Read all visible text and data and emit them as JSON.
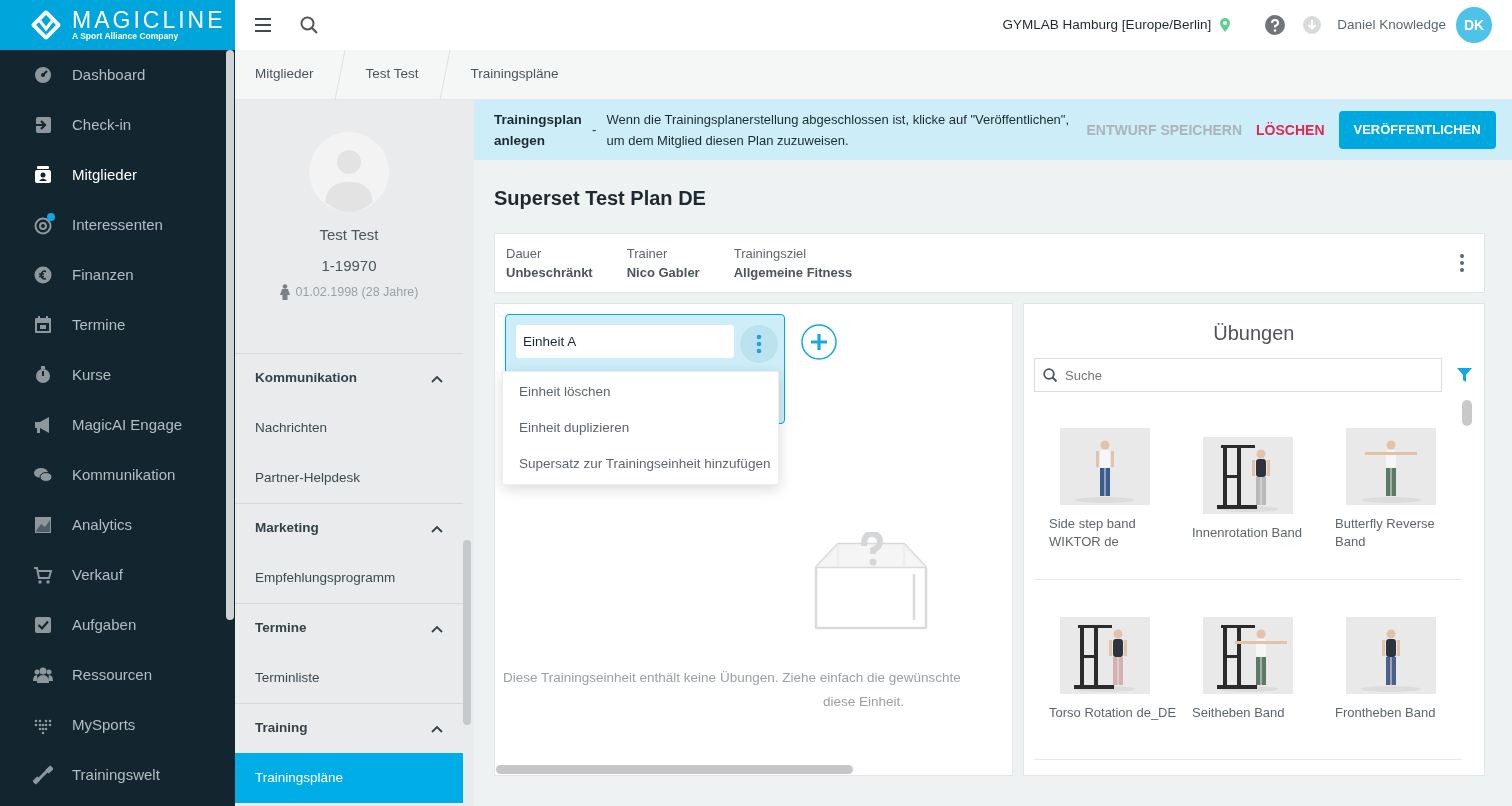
{
  "brand": {
    "name": "MAGICLINE",
    "tagline": "A Sport Alliance Company"
  },
  "nav": [
    {
      "label": "Dashboard",
      "selected": false,
      "notification": false
    },
    {
      "label": "Check-in",
      "selected": false,
      "notification": false
    },
    {
      "label": "Mitglieder",
      "selected": true,
      "notification": false
    },
    {
      "label": "Interessenten",
      "selected": false,
      "notification": true
    },
    {
      "label": "Finanzen",
      "selected": false,
      "notification": false
    },
    {
      "label": "Termine",
      "selected": false,
      "notification": false
    },
    {
      "label": "Kurse",
      "selected": false,
      "notification": false
    },
    {
      "label": "MagicAI Engage",
      "selected": false,
      "notification": false
    },
    {
      "label": "Kommunikation",
      "selected": false,
      "notification": false
    },
    {
      "label": "Analytics",
      "selected": false,
      "notification": false
    },
    {
      "label": "Verkauf",
      "selected": false,
      "notification": false
    },
    {
      "label": "Aufgaben",
      "selected": false,
      "notification": false
    },
    {
      "label": "Ressourcen",
      "selected": false,
      "notification": false
    },
    {
      "label": "MySports",
      "selected": false,
      "notification": false
    },
    {
      "label": "Trainingswelt",
      "selected": false,
      "notification": false
    }
  ],
  "header": {
    "location": "GYMLAB Hamburg [Europe/Berlin]",
    "user": "Daniel Knowledge",
    "initials": "DK"
  },
  "breadcrumbs": [
    "Mitglieder",
    "Test Test",
    "Trainingspläne"
  ],
  "member": {
    "name": "Test Test",
    "number": "1-19970",
    "birth": "01.02.1998 (28 Jahre)"
  },
  "sections": [
    {
      "title": "Kommunikation",
      "expanded": true,
      "items": [
        {
          "label": "Nachrichten",
          "selected": false
        },
        {
          "label": "Partner-Helpdesk",
          "selected": false
        }
      ]
    },
    {
      "title": "Marketing",
      "expanded": true,
      "items": [
        {
          "label": "Empfehlungsprogramm",
          "selected": false
        }
      ]
    },
    {
      "title": "Termine",
      "expanded": true,
      "items": [
        {
          "label": "Terminliste",
          "selected": false
        }
      ]
    },
    {
      "title": "Training",
      "expanded": true,
      "items": [
        {
          "label": "Trainingspläne",
          "selected": true
        }
      ]
    }
  ],
  "notice": {
    "title": "Trainingsplan anlegen",
    "separator": "-",
    "message": "Wenn die Trainingsplanerstellung abgeschlossen ist, klicke auf \"Veröffentlichen\", um dem Mitglied diesen Plan zuzuweisen."
  },
  "actions": [
    {
      "label": "ENTWURF SPEICHERN",
      "kind": "text",
      "disabled": true
    },
    {
      "label": "LÖSCHEN",
      "kind": "danger",
      "disabled": false
    },
    {
      "label": "VERÖFFENTLICHEN",
      "kind": "primary",
      "disabled": false
    }
  ],
  "plan": {
    "title": "Superset Test Plan DE",
    "fields": [
      {
        "label": "Dauer",
        "value": "Unbeschränkt"
      },
      {
        "label": "Trainer",
        "value": "Nico Gabler"
      },
      {
        "label": "Trainingsziel",
        "value": "Allgemeine Fitness"
      }
    ]
  },
  "unit": {
    "name": "Einheit A",
    "selected": true
  },
  "unit_menu": [
    "Einheit löschen",
    "Einheit duplizieren",
    "Supersatz zur Trainingseinheit hinzufügen"
  ],
  "empty_message": [
    "Diese Trainingseinheit enthält keine Übungen. Ziehe einfach die gewünschte",
    "diese Einheit."
  ],
  "exercises": {
    "title": "Übungen",
    "search_placeholder": "Suche",
    "items": [
      {
        "name": "Side step band WIKTOR de",
        "kind": "picture"
      },
      {
        "name": "Innenrotation Band",
        "kind": "picture"
      },
      {
        "name": "Butterfly Reverse Band",
        "kind": "picture"
      },
      {
        "name": "Torso Rotation de_DE",
        "kind": "picture"
      },
      {
        "name": "Seitheben Band",
        "kind": "picture"
      },
      {
        "name": "Frontheben Band",
        "kind": "picture"
      }
    ]
  }
}
